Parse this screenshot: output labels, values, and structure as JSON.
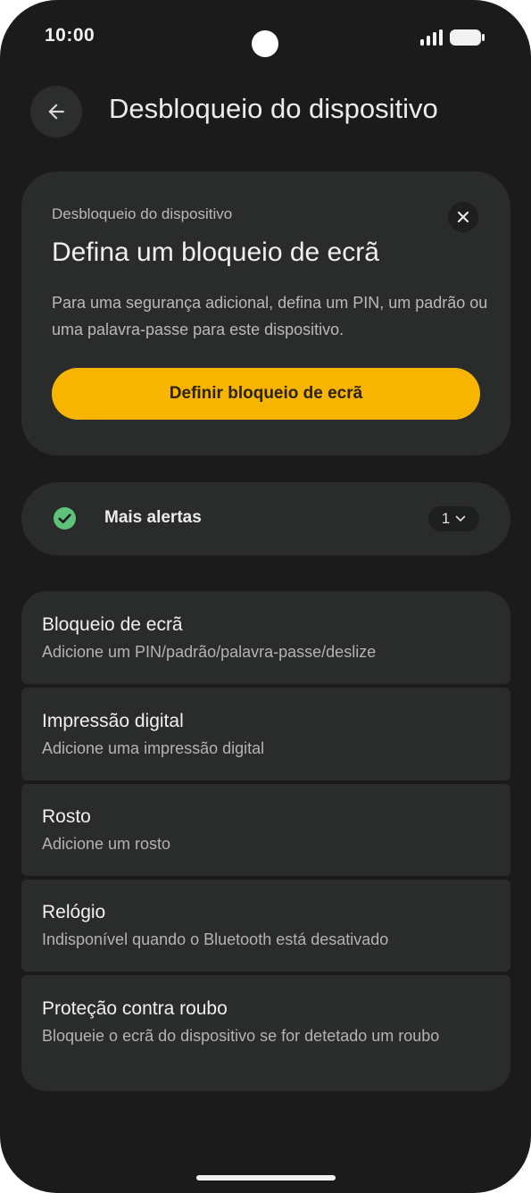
{
  "status_bar": {
    "time": "10:00",
    "signal_icon": "signal-bars-icon",
    "battery_icon": "battery-icon"
  },
  "header": {
    "back_icon": "arrow-back-icon",
    "title": "Desbloqueio do dispositivo"
  },
  "alert_card": {
    "eyebrow": "Desbloqueio do dispositivo",
    "title": "Defina um bloqueio de ecrã",
    "body": "Para uma segurança adicional, defina um PIN, um padrão ou uma palavra-passe para este dispositivo.",
    "button_label": "Definir bloqueio de ecrã",
    "close_icon": "close-icon"
  },
  "more_alerts": {
    "label": "Mais alertas",
    "count": "1",
    "icon": "check-circle-icon"
  },
  "settings": {
    "items": [
      {
        "title": "Bloqueio de ecrã",
        "subtitle": "Adicione um PIN/padrão/palavra-passe/deslize"
      },
      {
        "title": "Impressão digital",
        "subtitle": "Adicione uma impressão digital"
      },
      {
        "title": "Rosto",
        "subtitle": "Adicione um rosto"
      },
      {
        "title": "Relógio",
        "subtitle": "Indisponível quando o Bluetooth está desativado"
      },
      {
        "title": "Proteção contra roubo",
        "subtitle": "Bloqueie o ecrã do dispositivo se for detetado um roubo"
      }
    ]
  },
  "colors": {
    "background": "#1b1b1b",
    "surface": "#2a2b2b",
    "accent": "#f7b400",
    "success": "#5fc27a"
  }
}
